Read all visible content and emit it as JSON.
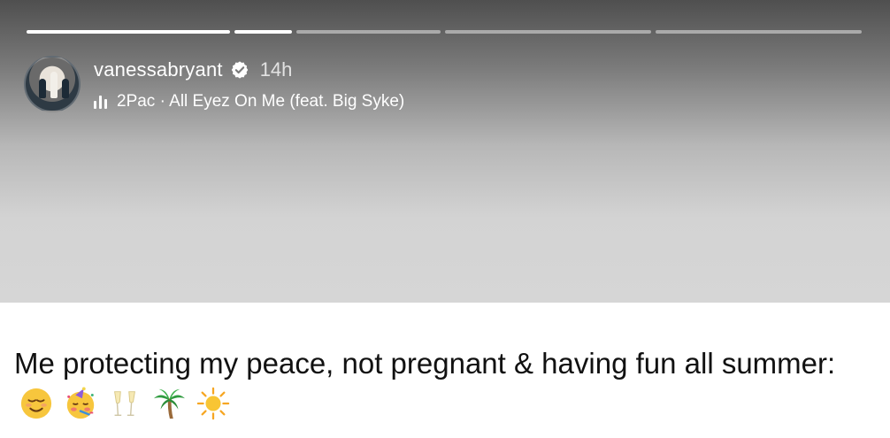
{
  "story": {
    "progress_segments": [
      {
        "label": "segment-1",
        "fill": 1.0,
        "width": 230
      },
      {
        "label": "segment-2",
        "fill": 1.0,
        "width": 65
      },
      {
        "label": "segment-3",
        "fill": 0.0,
        "width": 163
      },
      {
        "label": "segment-4",
        "fill": 0.0,
        "width": 233
      },
      {
        "label": "segment-5",
        "fill": 0.0,
        "width": 233
      }
    ]
  },
  "header": {
    "username": "vanessabryant",
    "verified": true,
    "time": "14h",
    "music": "2Pac · All Eyez On Me (feat. Big Syke)"
  },
  "caption": {
    "text": "Me protecting my peace, not pregnant & having fun all summer:",
    "emojis": [
      "relieved-face",
      "partying-face",
      "champagne-glasses",
      "palm-tree",
      "sun"
    ]
  },
  "colors": {
    "text_light": "#ffffff",
    "caption_text": "#111111"
  }
}
